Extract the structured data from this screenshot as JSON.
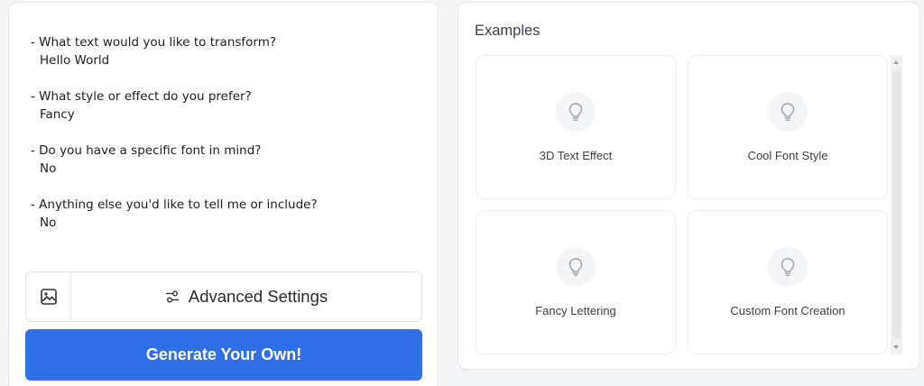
{
  "prompt": {
    "items": [
      {
        "question": "- What text would you like to transform?",
        "answer": "Hello World"
      },
      {
        "question": "- What style or effect do you prefer?",
        "answer": "Fancy"
      },
      {
        "question": "- Do you have a specific font in mind?",
        "answer": "No"
      },
      {
        "question": "- Anything else you'd like to tell me or include?",
        "answer": "No"
      }
    ]
  },
  "actions": {
    "advanced_settings_label": "Advanced Settings",
    "generate_label": "Generate Your Own!"
  },
  "examples": {
    "title": "Examples",
    "cards": [
      {
        "label": "3D Text Effect"
      },
      {
        "label": "Cool Font Style"
      },
      {
        "label": "Fancy Lettering"
      },
      {
        "label": "Custom Font Creation"
      }
    ]
  },
  "colors": {
    "primary": "#2f6fe8",
    "bulb_icon": "#9aa4ad"
  },
  "icons": {
    "image": "image-icon",
    "settings": "sliders-icon",
    "card": "lightbulb-icon"
  }
}
